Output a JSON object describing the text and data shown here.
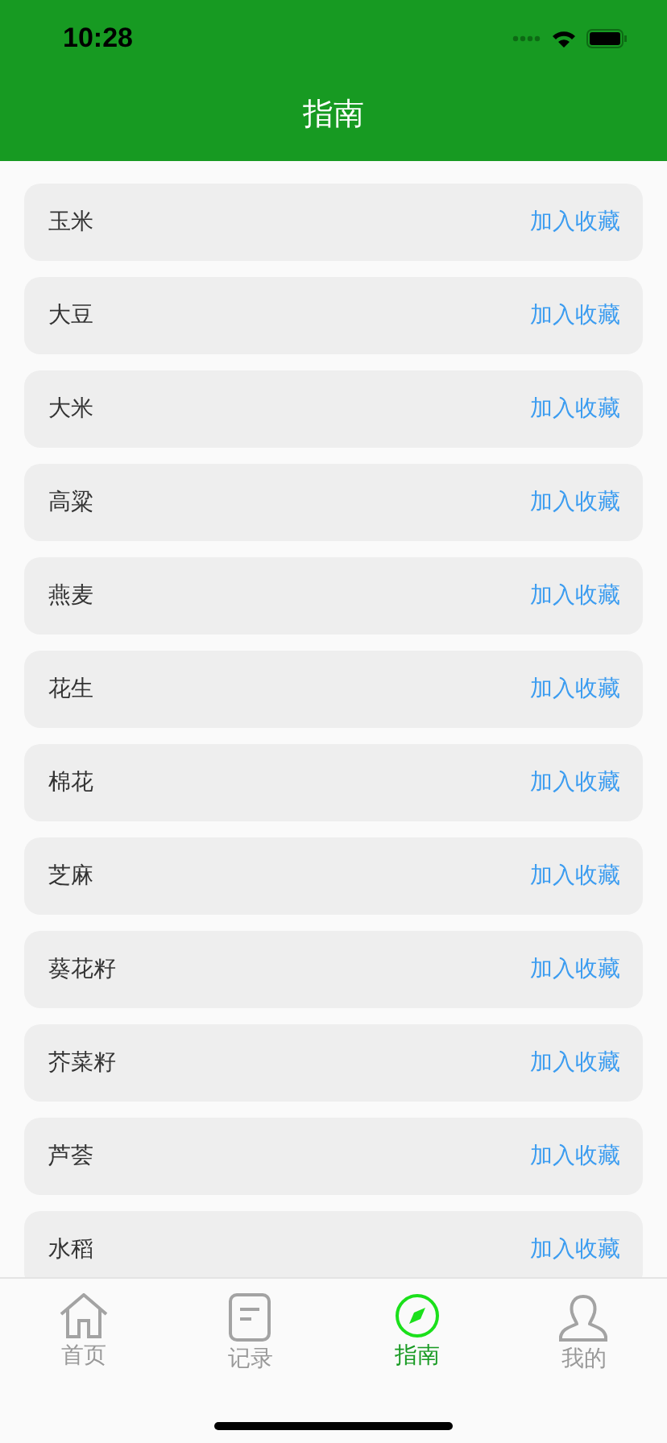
{
  "status_bar": {
    "time": "10:28"
  },
  "header": {
    "title": "指南"
  },
  "items": [
    {
      "name": "玉米",
      "action": "加入收藏"
    },
    {
      "name": "大豆",
      "action": "加入收藏"
    },
    {
      "name": "大米",
      "action": "加入收藏"
    },
    {
      "name": "高粱",
      "action": "加入收藏"
    },
    {
      "name": "燕麦",
      "action": "加入收藏"
    },
    {
      "name": "花生",
      "action": "加入收藏"
    },
    {
      "name": "棉花",
      "action": "加入收藏"
    },
    {
      "name": "芝麻",
      "action": "加入收藏"
    },
    {
      "name": "葵花籽",
      "action": "加入收藏"
    },
    {
      "name": "芥菜籽",
      "action": "加入收藏"
    },
    {
      "name": "芦荟",
      "action": "加入收藏"
    },
    {
      "name": "水稻",
      "action": "加入收藏"
    }
  ],
  "tab_bar": [
    {
      "kind": "home",
      "label": "首页",
      "selected": false
    },
    {
      "kind": "record",
      "label": "记录",
      "selected": false
    },
    {
      "kind": "compass",
      "label": "指南",
      "selected": true
    },
    {
      "kind": "person",
      "label": "我的",
      "selected": false
    }
  ]
}
